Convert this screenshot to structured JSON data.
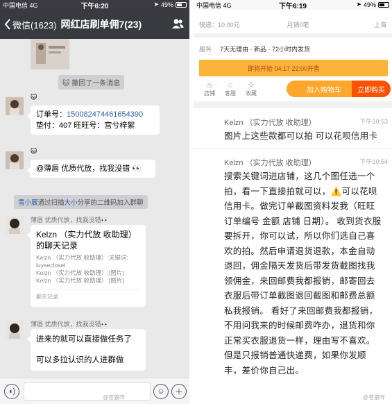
{
  "left": {
    "status": {
      "carrier": "中国电信 4G",
      "time": "下午6:20",
      "battery": "49%",
      "battery_level": 0.49
    },
    "nav": {
      "back": "微信(1623)",
      "title": "网红店刷单佣7(23)"
    },
    "recall_notice": "撤回了一条消息",
    "msg1": {
      "order_line": "订单号：",
      "order_no": "150082474461654390",
      "advance_line": "垫付：407 旺旺号：宫兮梓絮"
    },
    "msg2": {
      "text": "@薄唇   优质代放，找我没错"
    },
    "join_notice": {
      "inviter": "雪小展",
      "via": "通过扫描",
      "owner": "大小",
      "rest": "分享的二维码加入群聊"
    },
    "msg3": {
      "sender": "薄唇    优质代放，找我没错",
      "card_title": "Kelzn （实力代放 收助理）的聊天记录",
      "card_lines": [
        "Kelzn （实力代放 收助理）:关键词:",
        "luyeecloset",
        "Kelzn （实力代放 收助理）:[图片]",
        "Kelzn （实力代放 收助理）:[图片]"
      ],
      "card_footer": "聊天记录"
    },
    "msg4": {
      "sender": "薄唇    优质代放，找我没错",
      "line1": "进来的就可以直接做任务了",
      "line2": "可以多拉认识的人进群做"
    },
    "watermark": "@苍狼咩"
  },
  "right": {
    "status": {
      "carrier": "中国电信 4G",
      "time": "下午6:19",
      "battery": "49%",
      "battery_level": 0.49
    },
    "shop": {
      "top_fragment": "搜索关键词进店铺",
      "shipping": "快递：10.00元",
      "monthly": "月销0笔",
      "location": "上海",
      "service_label": "服务",
      "service_text": "7天无理由 · 新品 · 72小时内发货",
      "sale_text": "即将开始  04.17 22:00开售",
      "actions": [
        "店铺",
        "客服",
        "收藏"
      ],
      "cart": "加入购物车",
      "buy": "立即购买"
    },
    "msg1": {
      "sender": "Kelzn （实力代放 收助理）",
      "time": "下午10:53",
      "text": "图片上这些款都可以拍 可以花呗信用卡"
    },
    "msg2": {
      "sender": "Kelzn （实力代放 收助理）",
      "time": "下午10:54",
      "text": "搜索关键词进店铺，这几个图任选一个拍，看一下直接拍就可以，⚠️可以花呗信用卡。做完订单截图资料发我（旺旺 订单编号 金额 店铺 日期）。          收到货衣服要拆开，你可以试，所以你们选自己喜欢的拍。然后申请退货退款，本金自动退回，佣金隔天发货后带发货截图找我领佣金，来回邮费我都报销，邮寄回去衣服后带订单截图退回截图和邮费总额私我报销。    看好了来回邮费我都报销，不用问我来的时候邮费咋办，退货和你正常买衣服退货一样，理由写不喜欢。但是只报销普通快递费，如果你发顺丰，差价你自己出。"
    },
    "watermark": "@苍狼咩"
  }
}
